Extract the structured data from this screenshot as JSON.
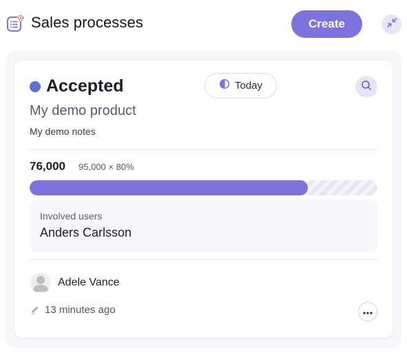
{
  "header": {
    "title": "Sales processes",
    "create_label": "Create",
    "icons": {
      "app": "list-gear-icon",
      "collapse": "collapse-arrows-icon"
    }
  },
  "card": {
    "status": {
      "label": "Accepted",
      "color": "#5b72d4"
    },
    "date_chip": {
      "label": "Today",
      "icon": "half-circle-icon"
    },
    "search_icon": "search-icon",
    "product": "My demo product",
    "notes": "My demo notes",
    "amount": "76,000",
    "formula": "95,000 × 80%",
    "progress_percent": 80,
    "involved_users": {
      "label": "Involved users",
      "name": "Anders Carlsson"
    },
    "owner": {
      "name": "Adele Vance",
      "avatar_icon": "person-avatar-icon"
    },
    "edited": {
      "icon": "pencil-icon",
      "text": "13 minutes ago"
    },
    "more_icon": "more-dots-icon"
  },
  "colors": {
    "accent": "#7e73dd",
    "accent_light": "#e7e4f7",
    "status_accepted": "#5b72d4"
  }
}
